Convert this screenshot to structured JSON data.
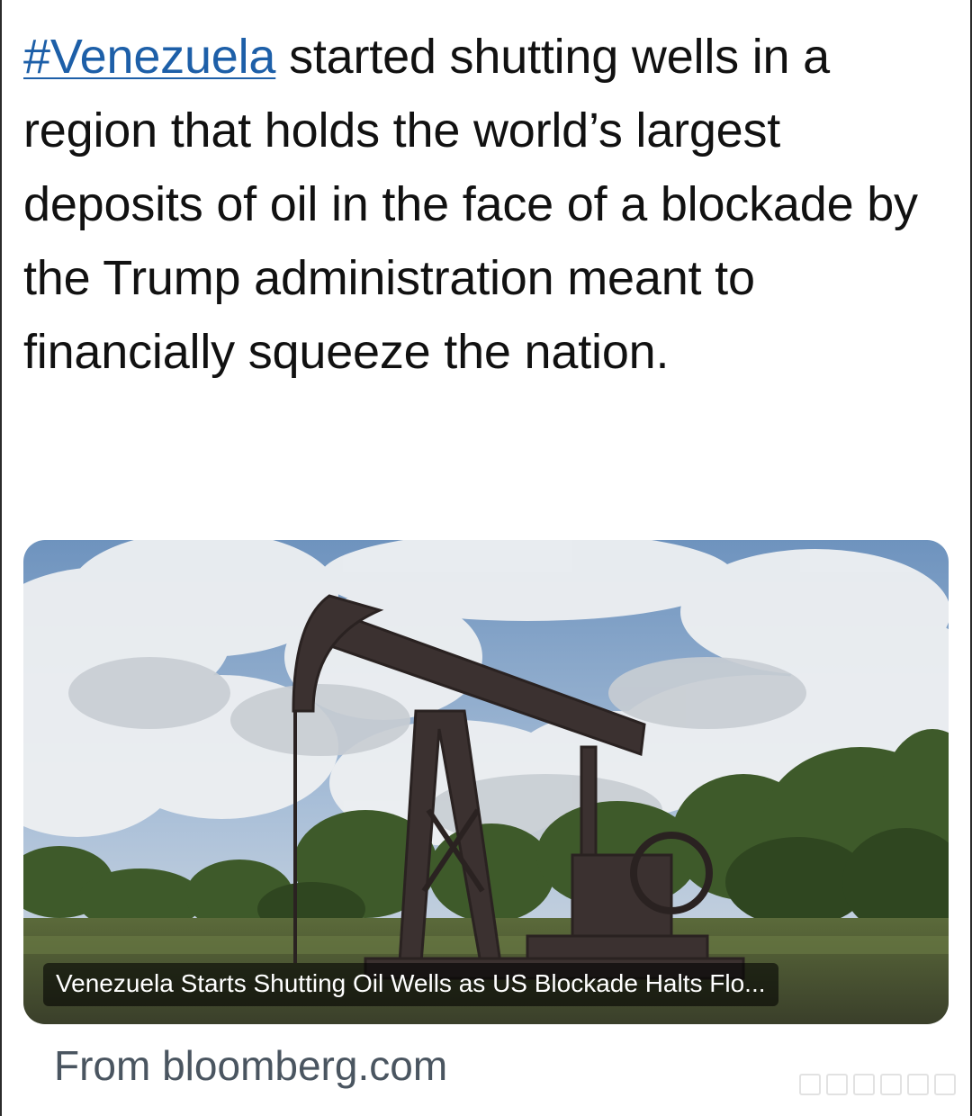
{
  "tweet": {
    "hashtag": "#Venezuela",
    "body": " started shutting wells in a region that holds the world’s largest deposits of oil in the face of a blockade by the Trump administration meant to financially squeeze the nation."
  },
  "link_card": {
    "headline": "Venezuela Starts Shutting Oil Wells as US Blockade Halts Flo...",
    "image_subject": "oil-pumpjack-photo"
  },
  "source": {
    "text": "From bloomberg.com"
  },
  "colors": {
    "hashtag": "#1d5fa8",
    "text": "#111111",
    "source_text": "#4a5560"
  }
}
